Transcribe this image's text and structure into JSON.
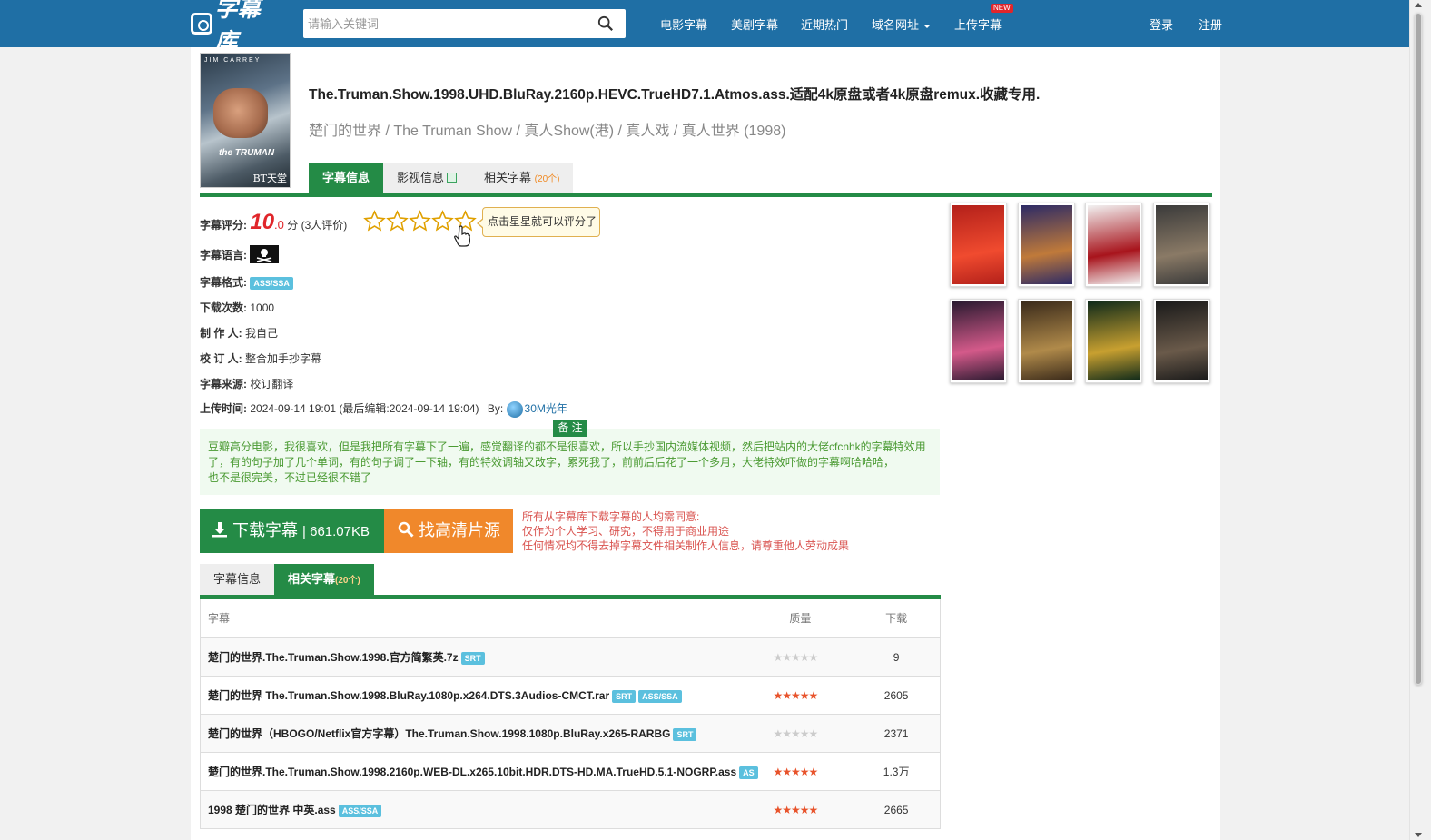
{
  "header": {
    "logo_text": "字幕库",
    "search_placeholder": "请输入关键词",
    "nav": [
      "电影字幕",
      "美剧字幕",
      "近期热门",
      "域名网址",
      "上传字幕"
    ],
    "new_badge": "NEW",
    "login": "登录",
    "register": "注册"
  },
  "poster": {
    "top_text": "JIM CARREY",
    "name_text": "the TRUMAN",
    "watermark": "BT天堂"
  },
  "title": "The.Truman.Show.1998.UHD.BluRay.2160p.HEVC.TrueHD7.1.Atmos.ass.适配4k原盘或者4k原盘remux.收藏专用.",
  "subtitle": "楚门的世界 / The Truman Show / 真人Show(港) / 真人戏 / 真人世界 (1998)",
  "tabs_top": [
    {
      "label": "字幕信息",
      "count": ""
    },
    {
      "label": "影视信息",
      "count": ""
    },
    {
      "label": "相关字幕",
      "count": "(20个)"
    }
  ],
  "info": {
    "rating_label": "字幕评分:",
    "rating_int": "10",
    "rating_dec": ".0",
    "rating_unit": "分",
    "rating_count": "(3人评价)",
    "rating_tooltip": "点击星星就可以评分了",
    "stars_total": 5,
    "language_label": "字幕语言:",
    "format_label": "字幕格式:",
    "format_value": "ASS/SSA",
    "downloads_label": "下载次数:",
    "downloads_value": "1000",
    "maker_label": "制 作 人:",
    "maker_value": "我自己",
    "proof_label": "校 订 人:",
    "proof_value": "整合加手抄字幕",
    "source_label": "字幕来源:",
    "source_value": "校订翻译",
    "upload_label": "上传时间:",
    "upload_value": "2024-09-14 19:01 (最后编辑:2024-09-14 19:04)",
    "by_label": "By:",
    "uploader": "30M光年"
  },
  "note": {
    "tag": "备 注",
    "lines": [
      "豆瓣高分电影，我很喜欢，但是我把所有字幕下了一遍，感觉翻译的都不是很喜欢，所以手抄国内流媒体视频，然后把站内的大佬cfcnhk的字幕特效用",
      "了，有的句子加了几个单词，有的句子调了一下轴，有的特效调轴又改字，累死我了，前前后后花了一个多月，大佬特效吓做的字幕啊哈哈哈，",
      "也不是很完美，不过已经很不错了"
    ]
  },
  "download": {
    "label": "下载字幕",
    "size": "| 661.07KB",
    "find_label": "找高清片源",
    "disclaimer": [
      "所有从字幕库下载字幕的人均需同意:",
      "仅作为个人学习、研究，不得用于商业用途",
      "任何情况均不得去掉字幕文件相关制作人信息，请尊重他人劳动成果"
    ]
  },
  "tabs_bottom": [
    {
      "label": "字幕信息",
      "count": ""
    },
    {
      "label": "相关字幕",
      "count": "(20个)"
    }
  ],
  "table": {
    "headers": [
      "字幕",
      "质量",
      "下载"
    ],
    "rows": [
      {
        "name": "楚门的世界.The.Truman.Show.1998.官方简繁英.7z",
        "badges": [
          "SRT"
        ],
        "quality": 0,
        "downloads": "9"
      },
      {
        "name": "楚门的世界 The.Truman.Show.1998.BluRay.1080p.x264.DTS.3Audios-CMCT.rar",
        "badges": [
          "SRT",
          "ASS/SSA"
        ],
        "quality": 5,
        "downloads": "2605"
      },
      {
        "name": "楚门的世界（HBOGO/Netflix官方字幕）The.Truman.Show.1998.1080p.BluRay.x265-RARBG",
        "badges": [
          "SRT"
        ],
        "quality": 0,
        "downloads": "2371"
      },
      {
        "name": "楚门的世界.The.Truman.Show.1998.2160p.WEB-DL.x265.10bit.HDR.DTS-HD.MA.TrueHD.5.1-NOGRP.ass",
        "badges": [
          "AS"
        ],
        "quality": 5,
        "downloads": "1.3万"
      },
      {
        "name": "1998 楚门的世界 中英.ass",
        "badges": [
          "ASS/SSA"
        ],
        "quality": 5,
        "downloads": "2665"
      }
    ]
  },
  "thumbnails": [
    {
      "name": "thumb-1",
      "colors": [
        "#b3201a",
        "#f04b2f"
      ]
    },
    {
      "name": "thumb-2",
      "colors": [
        "#2c2a66",
        "#c07a3a"
      ]
    },
    {
      "name": "thumb-3",
      "colors": [
        "#f2f2f2",
        "#a8141c"
      ]
    },
    {
      "name": "thumb-4",
      "colors": [
        "#3a3a3a",
        "#8a7a66"
      ]
    },
    {
      "name": "thumb-5",
      "colors": [
        "#2a1a30",
        "#d45a8a"
      ]
    },
    {
      "name": "thumb-6",
      "colors": [
        "#3a2a1a",
        "#b08a4a"
      ]
    },
    {
      "name": "thumb-7",
      "colors": [
        "#0f2a1a",
        "#c8a030"
      ]
    },
    {
      "name": "thumb-8",
      "colors": [
        "#1a1a1a",
        "#6a5a4a"
      ]
    }
  ],
  "colors": {
    "header": "#1f6fa5",
    "accent_green": "#248b46",
    "accent_orange": "#f0882b",
    "rating_red": "#e0262b"
  }
}
